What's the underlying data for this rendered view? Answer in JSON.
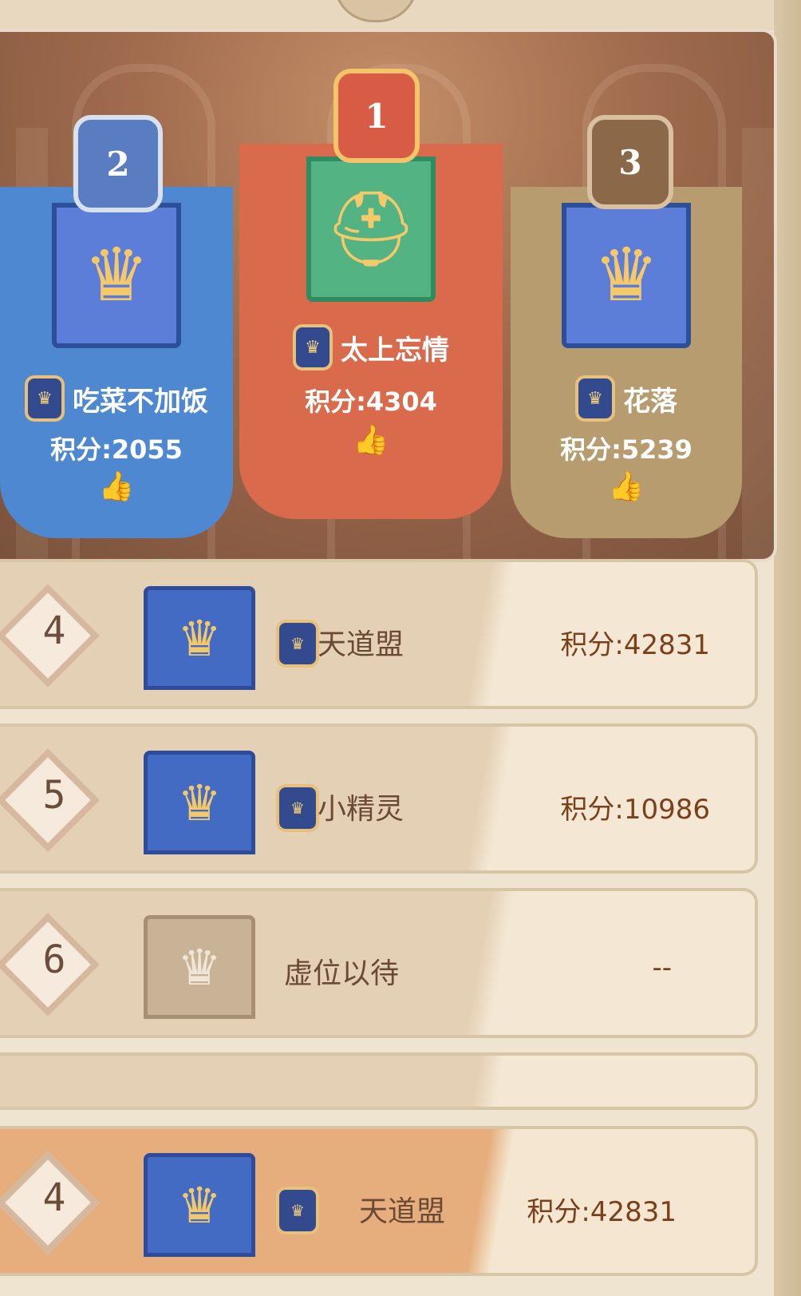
{
  "podium": {
    "first": {
      "rank": "1",
      "name": "太上忘情",
      "score": "积分:4304",
      "color": "#d96a4c"
    },
    "second": {
      "rank": "2",
      "name": "吃菜不加饭",
      "score": "积分:2055",
      "color": "#4d88d0"
    },
    "third": {
      "rank": "3",
      "name": "花落",
      "score": "积分:5239",
      "color": "#b79c6f"
    }
  },
  "list": [
    {
      "rank": "4",
      "name": "天道盟",
      "score": "积分:42831",
      "icon": "crown-banner-icon"
    },
    {
      "rank": "5",
      "name": "小精灵",
      "score": "积分:10986",
      "icon": "crown-banner-icon"
    },
    {
      "rank": "6",
      "name": "虚位以待",
      "score": "--",
      "icon": "empty-banner-icon"
    }
  ],
  "me": {
    "rank": "4",
    "name": "天道盟",
    "score": "积分:42831",
    "icon": "crown-banner-icon"
  },
  "colors": {
    "accent": "#f3c868",
    "row_score": "#7a3f1b"
  }
}
